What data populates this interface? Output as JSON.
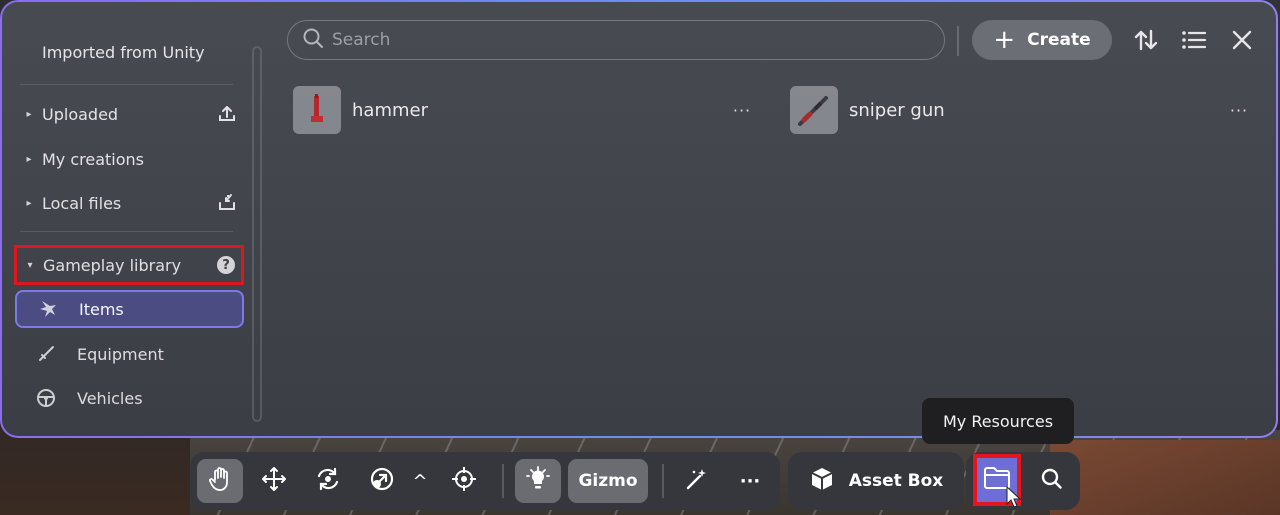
{
  "sidebar": {
    "header": "Imported from Unity",
    "sections": [
      {
        "label": "Uploaded",
        "caret": "▸",
        "icon": "upload-icon"
      },
      {
        "label": "My creations",
        "caret": "▸"
      },
      {
        "label": "Local files",
        "caret": "▸",
        "icon": "local-import-icon"
      },
      {
        "label": "Gameplay library",
        "caret": "▾",
        "icon": "help-icon",
        "help_glyph": "?"
      }
    ],
    "library_items": [
      {
        "label": "Items",
        "icon": "sparkle-star-icon",
        "active": true
      },
      {
        "label": "Equipment",
        "icon": "sword-icon"
      },
      {
        "label": "Vehicles",
        "icon": "steering-wheel-icon"
      }
    ]
  },
  "topbar": {
    "search_placeholder": "Search",
    "create_label": "Create",
    "create_icon": "+",
    "sort_icon": "sort-icon",
    "list_icon": "list-view-icon",
    "close_icon": "close-icon"
  },
  "assets": [
    {
      "name": "hammer",
      "more": "···"
    },
    {
      "name": "sniper gun",
      "more": "···"
    }
  ],
  "tooltip": "My Resources",
  "toolbar": {
    "gizmo_label": "Gizmo",
    "asset_box_label": "Asset Box",
    "more_glyph": "···",
    "caret_glyph": "^"
  },
  "colors": {
    "panel_border_start": "#8b6cf0",
    "panel_border_end": "#6a8ef2",
    "active_item_bg": "#4d4f86",
    "highlight_red": "#e5161b",
    "resources_button": "#6d6fd6"
  }
}
